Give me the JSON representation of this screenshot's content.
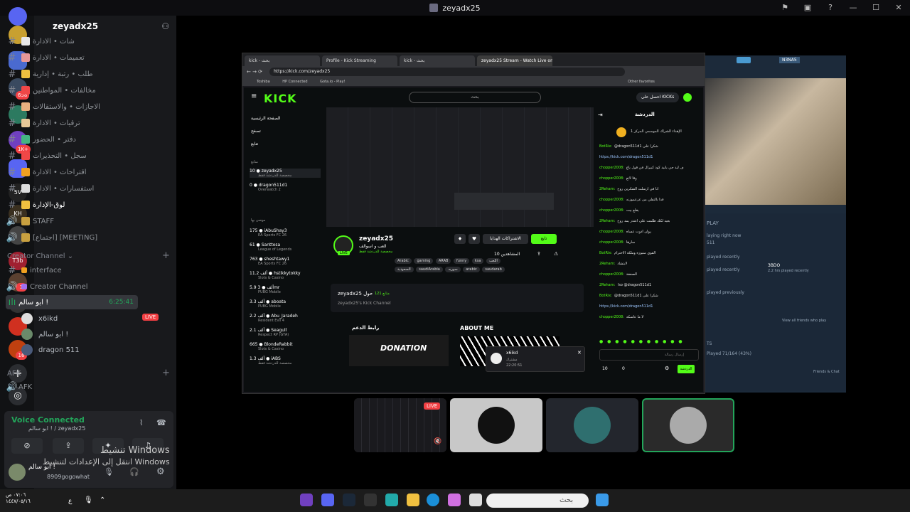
{
  "window": {
    "title": "zeyadx25"
  },
  "server": {
    "name": "zeyadx25"
  },
  "rail_badges": [
    "658",
    "1K+",
    "1",
    "16"
  ],
  "channels": [
    {
      "label": "شات • الادارة",
      "color": "#e8e8e8"
    },
    {
      "label": "تعميمات • الادارة",
      "color": "#e89898"
    },
    {
      "label": "طلب • رتبة • إدارية",
      "color": "#f0c040"
    },
    {
      "label": "مخالفات • المواطنين",
      "color": "#f04747"
    },
    {
      "label": "الاجازات • والاستقالات",
      "color": "#e8b080"
    },
    {
      "label": "ترقيات • الادارة",
      "color": "#e8c898"
    },
    {
      "label": "دفتر • الحضور",
      "color": "#43b581"
    },
    {
      "label": "سجل • التحذيرات",
      "color": "#f04747"
    },
    {
      "label": "اقتراحات • الادارة",
      "color": "#f0a020"
    },
    {
      "label": "استفسارات • الادارة",
      "color": "#dddddd"
    },
    {
      "label": "لوق-الإدارة",
      "color": "#f0c040"
    },
    {
      "label": "STAFF",
      "color": "#c8a040"
    },
    {
      "label": "[اجتماع] [MEETING]",
      "color": "#c8a040"
    }
  ],
  "categories": {
    "creator": "Creator Channel",
    "afk": "AFK"
  },
  "creator_channels": {
    "interface": "interface",
    "voice": "Creator Channel"
  },
  "voice_channel": {
    "name": "ابو سالم !",
    "timer": "6:25:41"
  },
  "voice_users": [
    {
      "name": "x6ikd",
      "live": "LIVE"
    },
    {
      "name": "ابو سالم !"
    },
    {
      "name": "dragon 511"
    }
  ],
  "afk_channel": "AFK",
  "voice_panel": {
    "status": "Voice Connected",
    "sub": "ابو سالم ! / zeyadx25"
  },
  "user": {
    "name": "ابو سالم !",
    "tag": "8909gogowhat"
  },
  "watermark": {
    "line1": "تنشيط Windows",
    "line2": "انتقل إلى الإعدادات لتنشيط Windows"
  },
  "browser": {
    "tabs": [
      "kick - بحث",
      "Profile - Kick Streaming",
      "kick - بحث",
      "zeyadx25 Stream - Watch Live on"
    ],
    "url": "https://kick.com/zeyadx25",
    "bookmarks": [
      "Toshiba",
      "HP Connected",
      "Gota.io - Play!",
      "Other favorites"
    ]
  },
  "kick": {
    "logo": "KICK",
    "search_placeholder": "بحث",
    "earn_button": "احصل على KICKs",
    "nav": [
      "الصفحة الرئيسية",
      "تصفح",
      "تتابع"
    ],
    "following_label": "متابع",
    "recommended_label": "موصى بها",
    "streamers": [
      {
        "count": "10",
        "name": "zeyadx25",
        "game": "مخصصة للدردشة فقط"
      },
      {
        "count": "0",
        "name": "dragon511d1",
        "game": "Overwatch 2"
      },
      {
        "count": "175",
        "name": "iAbuShay3",
        "game": "EA Sports FC 26"
      },
      {
        "count": "61",
        "name": "Santtosa",
        "game": "League of Legends"
      },
      {
        "count": "763",
        "name": "sheshtawy1",
        "game": "EA Sports FC 26"
      },
      {
        "count": "11.2 ألف",
        "name": "hstikkytokky",
        "game": "Slots & Casino"
      },
      {
        "count": "5.9 ألف",
        "name": "3mr",
        "game": "PUBG Mobile"
      },
      {
        "count": "3.3 ألف",
        "name": "aboata",
        "game": "PUBG Mobile"
      },
      {
        "count": "2.2 ألف",
        "name": "Abu_Jaradeh",
        "game": "Resident Evil 4"
      },
      {
        "count": "2.1 ألف",
        "name": "Seagull",
        "game": "Respect RP (GTA)"
      },
      {
        "count": "665",
        "name": "BlondeRabbit",
        "game": "Slots & Casino"
      },
      {
        "count": "1.3 ألف",
        "name": "iABS",
        "game": "مخصصة للدردشة فقط"
      }
    ],
    "channel": {
      "name": "zeyadx25",
      "subtitle": "العب و اسوالف",
      "category": "مخصصة للدردشة فقط",
      "live": "LIVE",
      "tags": [
        "Arabic",
        "gaming",
        "ARAB",
        "funny",
        "ksa",
        "اللعب",
        "السعودية",
        "saudiArabia",
        "سوريه",
        "arabic",
        "saudarab"
      ],
      "viewers": "10 المشاهدين",
      "follow": "تابع",
      "subscribe": "الاشتراكات الهدايا"
    },
    "about": {
      "followers": "121 متابع",
      "name": "zeyadx25 حول",
      "desc": "zeyadx25's Kick Channel"
    },
    "sections": {
      "about": "ABOUT ME",
      "donate": "رابط الدعم",
      "donation_banner": "DONATION"
    },
    "popup": {
      "name": "x6ikd",
      "sub": "مشترك",
      "time": "22:20:51"
    },
    "chat_title": "الدردشة",
    "chat_pinned": "الإهداء الشراك الموسمي المركز 1",
    "chat_input": "إرسال رسالة",
    "chat_button": "الدردشة",
    "chat_viewers": "10",
    "chat_count": "0",
    "chat": [
      {
        "user": "BotRix:",
        "text": "@dragon511d1 شكرا على"
      },
      {
        "link": "https://kick.com/dragon511d1"
      },
      {
        "user": "chopper2008:",
        "text": "ف لبد جي يابيد كود كبيرال في قول ياع"
      },
      {
        "user": "chopper2008:",
        "text": "وقا لاتع"
      },
      {
        "user": "2Reham:",
        "text": "انا في ارسلت الشكرين روح"
      },
      {
        "user": "chopper2008:",
        "text": "قدا بالتفلي من عزعموزنه"
      },
      {
        "user": "chopper2008:",
        "text": "يقلع بيت"
      },
      {
        "user": "2Reham:",
        "text": "بعيد لكك ظلمت علي اعتذر يمد روح"
      },
      {
        "user": "chopper2008:",
        "text": "روان ادوت عساه"
      },
      {
        "user": "chopper2008:",
        "text": "سارها"
      },
      {
        "user": "BotRix:",
        "text": "القوي منبوزه وملكة الاحترام"
      },
      {
        "user": "2Reham:",
        "text": "لابتشاد"
      },
      {
        "user": "chopper2008:",
        "text": "الصفقة"
      },
      {
        "user": "2Reham:",
        "text": "!so @dragon511d1"
      },
      {
        "user": "BotRix:",
        "text": "@dragon511d1 شكرا على"
      },
      {
        "link": "https://kick.com/dragon511d1"
      },
      {
        "user": "chopper2008:",
        "text": "لا ما عاسكه"
      }
    ]
  },
  "steam": {
    "status": "N3NA5",
    "items": [
      "PLAY",
      "laying right now",
      "511",
      "played recently",
      "played recently",
      "played previously",
      "View all friends who play",
      "TS",
      "Played 71/164 (43%)",
      "Friends & Chat",
      "3BDO",
      "2.2 hrs played recently"
    ]
  },
  "taskbar": {
    "search": "بحث",
    "time": "٠٧:٠٦ ص",
    "date": "١٤٤٧/٠٥/١٦",
    "lang": "ع"
  }
}
